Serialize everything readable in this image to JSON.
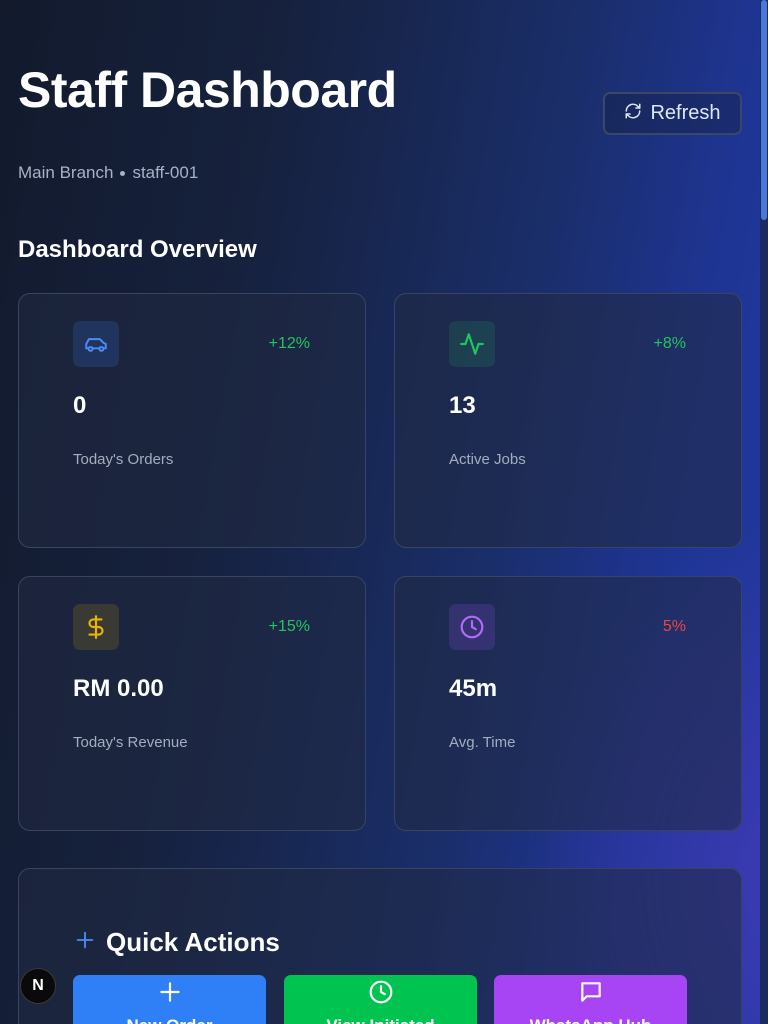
{
  "header": {
    "title": "Staff Dashboard",
    "refresh_label": "Refresh",
    "branch": "Main Branch",
    "staff_id": "staff-001"
  },
  "overview": {
    "title": "Dashboard Overview",
    "cards": [
      {
        "icon": "car-icon",
        "change": "+12%",
        "value": "0",
        "label": "Today's Orders",
        "accent": "#3b82f6",
        "change_color": "#22c55e"
      },
      {
        "icon": "activity-icon",
        "change": "+8%",
        "value": "13",
        "label": "Active Jobs",
        "accent": "#22c55e",
        "change_color": "#22c55e"
      },
      {
        "icon": "dollar-icon",
        "change": "+15%",
        "value": "RM 0.00",
        "label": "Today's Revenue",
        "accent": "#eab308",
        "change_color": "#22c55e"
      },
      {
        "icon": "clock-icon",
        "change": "5%",
        "value": "45m",
        "label": "Avg. Time",
        "accent": "#a855f7",
        "change_color": "#ef4444"
      }
    ]
  },
  "quick_actions": {
    "title": "Quick Actions",
    "buttons": [
      {
        "label": "New Order",
        "icon": "plus-icon",
        "color": "#2f80f6"
      },
      {
        "label": "View Initiated",
        "icon": "clock-icon",
        "color": "#00c44f"
      },
      {
        "label": "WhatsApp Hub",
        "icon": "message-icon",
        "color": "#a745f5"
      }
    ]
  },
  "badge": {
    "label": "N"
  }
}
